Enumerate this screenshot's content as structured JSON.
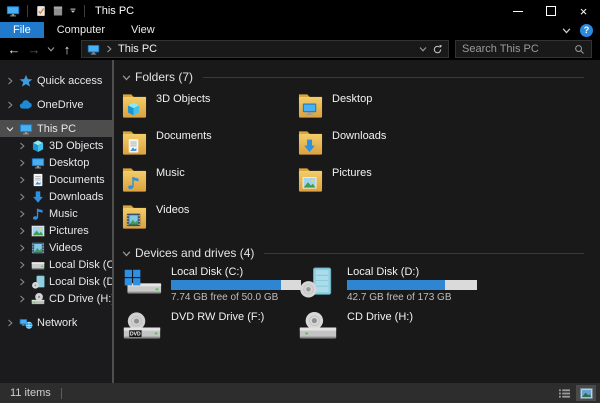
{
  "window": {
    "title": "This PC"
  },
  "titlebar": {
    "app_icon": "this-pc-monitor",
    "quick_access_toolbar": [
      "properties",
      "new-folder",
      "customize-dropdown"
    ],
    "buttons": [
      "minimize",
      "maximize",
      "close"
    ]
  },
  "menu": {
    "tabs": [
      {
        "label": "File",
        "active": true
      },
      {
        "label": "Computer",
        "active": false
      },
      {
        "label": "View",
        "active": false
      }
    ],
    "help_label": "?"
  },
  "navbar": {
    "back": "back",
    "forward": "forward",
    "recent": "recent-locations",
    "up": "up",
    "address": {
      "location": "This PC"
    },
    "search": {
      "placeholder": "Search This PC"
    }
  },
  "sidebar": {
    "items": [
      {
        "label": "Quick access",
        "icon": "star-icon",
        "level": 0,
        "expander": "right",
        "gap": true,
        "selected": false
      },
      {
        "label": "OneDrive",
        "icon": "cloud-icon",
        "level": 0,
        "expander": "right",
        "gap": true,
        "selected": false
      },
      {
        "label": "This PC",
        "icon": "monitor-icon",
        "level": 0,
        "expander": "down",
        "gap": true,
        "selected": true
      },
      {
        "label": "3D Objects",
        "icon": "cube-icon",
        "level": 1,
        "expander": "right",
        "gap": false,
        "selected": false
      },
      {
        "label": "Desktop",
        "icon": "monitor-icon",
        "level": 1,
        "expander": "right",
        "gap": false,
        "selected": false
      },
      {
        "label": "Documents",
        "icon": "page-icon",
        "level": 1,
        "expander": "right",
        "gap": false,
        "selected": false
      },
      {
        "label": "Downloads",
        "icon": "download-icon",
        "level": 1,
        "expander": "right",
        "gap": false,
        "selected": false
      },
      {
        "label": "Music",
        "icon": "note-icon",
        "level": 1,
        "expander": "right",
        "gap": false,
        "selected": false
      },
      {
        "label": "Pictures",
        "icon": "photo-icon",
        "level": 1,
        "expander": "right",
        "gap": false,
        "selected": false
      },
      {
        "label": "Videos",
        "icon": "film-icon",
        "level": 1,
        "expander": "right",
        "gap": false,
        "selected": false
      },
      {
        "label": "Local Disk (C:)",
        "icon": "hdd-icon",
        "level": 1,
        "expander": "right",
        "gap": false,
        "selected": false
      },
      {
        "label": "Local Disk (D:)",
        "icon": "disk-icon",
        "level": 1,
        "expander": "right",
        "gap": false,
        "selected": false
      },
      {
        "label": "CD Drive (H:)",
        "icon": "cd-icon",
        "level": 1,
        "expander": "right",
        "gap": false,
        "selected": false
      },
      {
        "label": "Network",
        "icon": "network-icon",
        "level": 0,
        "expander": "right",
        "gap": true,
        "selected": false
      }
    ]
  },
  "main": {
    "sections": [
      {
        "title": "Folders",
        "count": 7,
        "kind": "folders",
        "items": [
          {
            "name": "3D Objects",
            "icon": "folder-cube-icon"
          },
          {
            "name": "Desktop",
            "icon": "folder-monitor-icon"
          },
          {
            "name": "Documents",
            "icon": "folder-page-icon"
          },
          {
            "name": "Downloads",
            "icon": "folder-download-icon"
          },
          {
            "name": "Music",
            "icon": "folder-note-icon"
          },
          {
            "name": "Pictures",
            "icon": "folder-photo-icon"
          },
          {
            "name": "Videos",
            "icon": "folder-film-icon"
          }
        ]
      },
      {
        "title": "Devices and drives",
        "count": 4,
        "kind": "drives",
        "items": [
          {
            "name": "Local Disk (C:)",
            "icon": "hdd-windows-icon",
            "used_percent": 84.5,
            "free_text": "7.74 GB free of 50.0 GB"
          },
          {
            "name": "Local Disk (D:)",
            "icon": "disk-drive-icon",
            "used_percent": 75.3,
            "free_text": "42.7 GB free of 173 GB"
          },
          {
            "name": "DVD RW Drive (F:)",
            "icon": "dvd-drive-icon"
          },
          {
            "name": "CD Drive (H:)",
            "icon": "cd-drive-icon"
          }
        ]
      }
    ]
  },
  "statusbar": {
    "items_count": "11 items"
  },
  "colors": {
    "accent_blue": "#2079ca",
    "help_blue": "#2a8ae0",
    "bar_fill": "#2e86d2",
    "bar_track": "#dadada",
    "selection_gray": "#4d4d4d",
    "folder_yellow_top": "#f2cd68",
    "folder_yellow_bottom": "#dca13e",
    "chrome_black": "#000000",
    "pane_dark": "#191919",
    "statusbar_gray": "#2d2d2d"
  }
}
